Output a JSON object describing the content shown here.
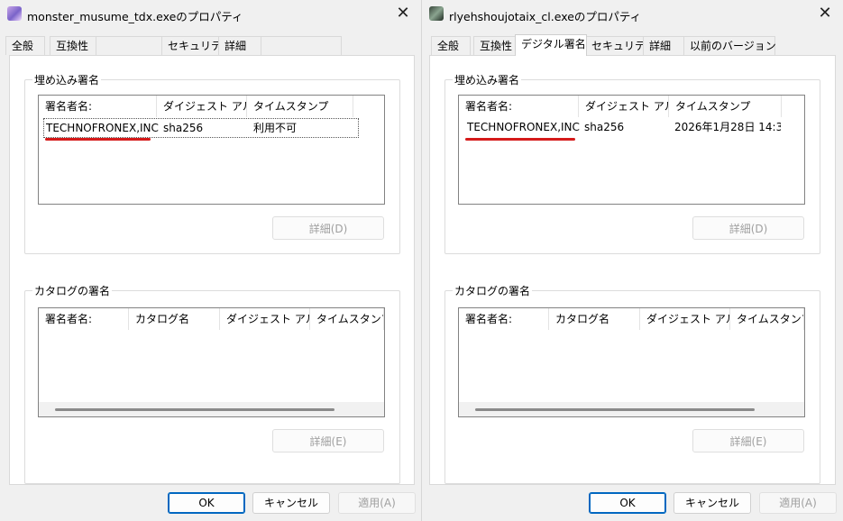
{
  "left": {
    "title": "monster_musume_tdx.exeのプロパティ",
    "tabs": [
      "全般",
      "互換性",
      "",
      "セキュリティ",
      "詳細",
      ""
    ],
    "embedded": {
      "label": "埋め込み署名",
      "headers": [
        "署名者名:",
        "ダイジェスト アル...",
        "タイムスタンプ"
      ],
      "row": [
        "TECHNOFRONEX,INC.",
        "sha256",
        "利用不可"
      ],
      "details_button": "詳細(D)"
    },
    "catalog": {
      "label": "カタログの署名",
      "headers": [
        "署名者名:",
        "カタログ名",
        "ダイジェスト アル...",
        "タイムスタンプ"
      ],
      "details_button": "詳細(E)"
    },
    "buttons": {
      "ok": "OK",
      "cancel": "キャンセル",
      "apply": "適用(A)"
    }
  },
  "right": {
    "title": "rlyehshoujotaix_cl.exeのプロパティ",
    "tabs": [
      "全般",
      "互換性",
      "デジタル署名",
      "セキュリティ",
      "詳細",
      "以前のバージョン"
    ],
    "embedded": {
      "label": "埋め込み署名",
      "headers": [
        "署名者名:",
        "ダイジェスト アル...",
        "タイムスタンプ"
      ],
      "row": [
        "TECHNOFRONEX,INC.",
        "sha256",
        "2026年1月28日 14:3..."
      ],
      "details_button": "詳細(D)"
    },
    "catalog": {
      "label": "カタログの署名",
      "headers": [
        "署名者名:",
        "カタログ名",
        "ダイジェスト アル...",
        "タイムスタンプ"
      ],
      "details_button": "詳細(E)"
    },
    "buttons": {
      "ok": "OK",
      "cancel": "キャンセル",
      "apply": "適用(A)"
    }
  },
  "colors": {
    "underline": "#d51a1a",
    "accent": "#0067c0"
  },
  "icons": {
    "close": "close-icon",
    "app": "app-icon"
  }
}
